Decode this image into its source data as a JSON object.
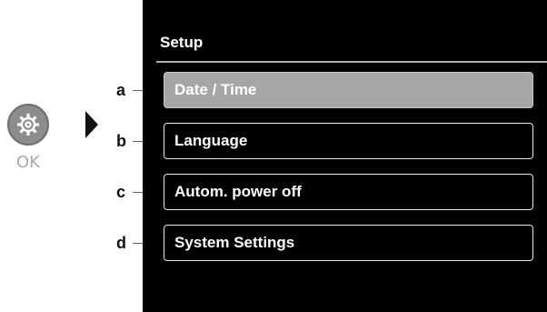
{
  "device": {
    "ok_label": "OK",
    "ok_icon": "gear-icon"
  },
  "screen": {
    "title": "Setup",
    "menu": [
      {
        "label": "Date / Time",
        "selected": true
      },
      {
        "label": "Language",
        "selected": false
      },
      {
        "label": "Autom. power off",
        "selected": false
      },
      {
        "label": "System Settings",
        "selected": false
      }
    ]
  },
  "callouts": [
    "a",
    "b",
    "c",
    "d"
  ],
  "colors": {
    "screen_bg": "#000000",
    "selected_bg": "#a6a6a6",
    "text": "#ffffff"
  }
}
